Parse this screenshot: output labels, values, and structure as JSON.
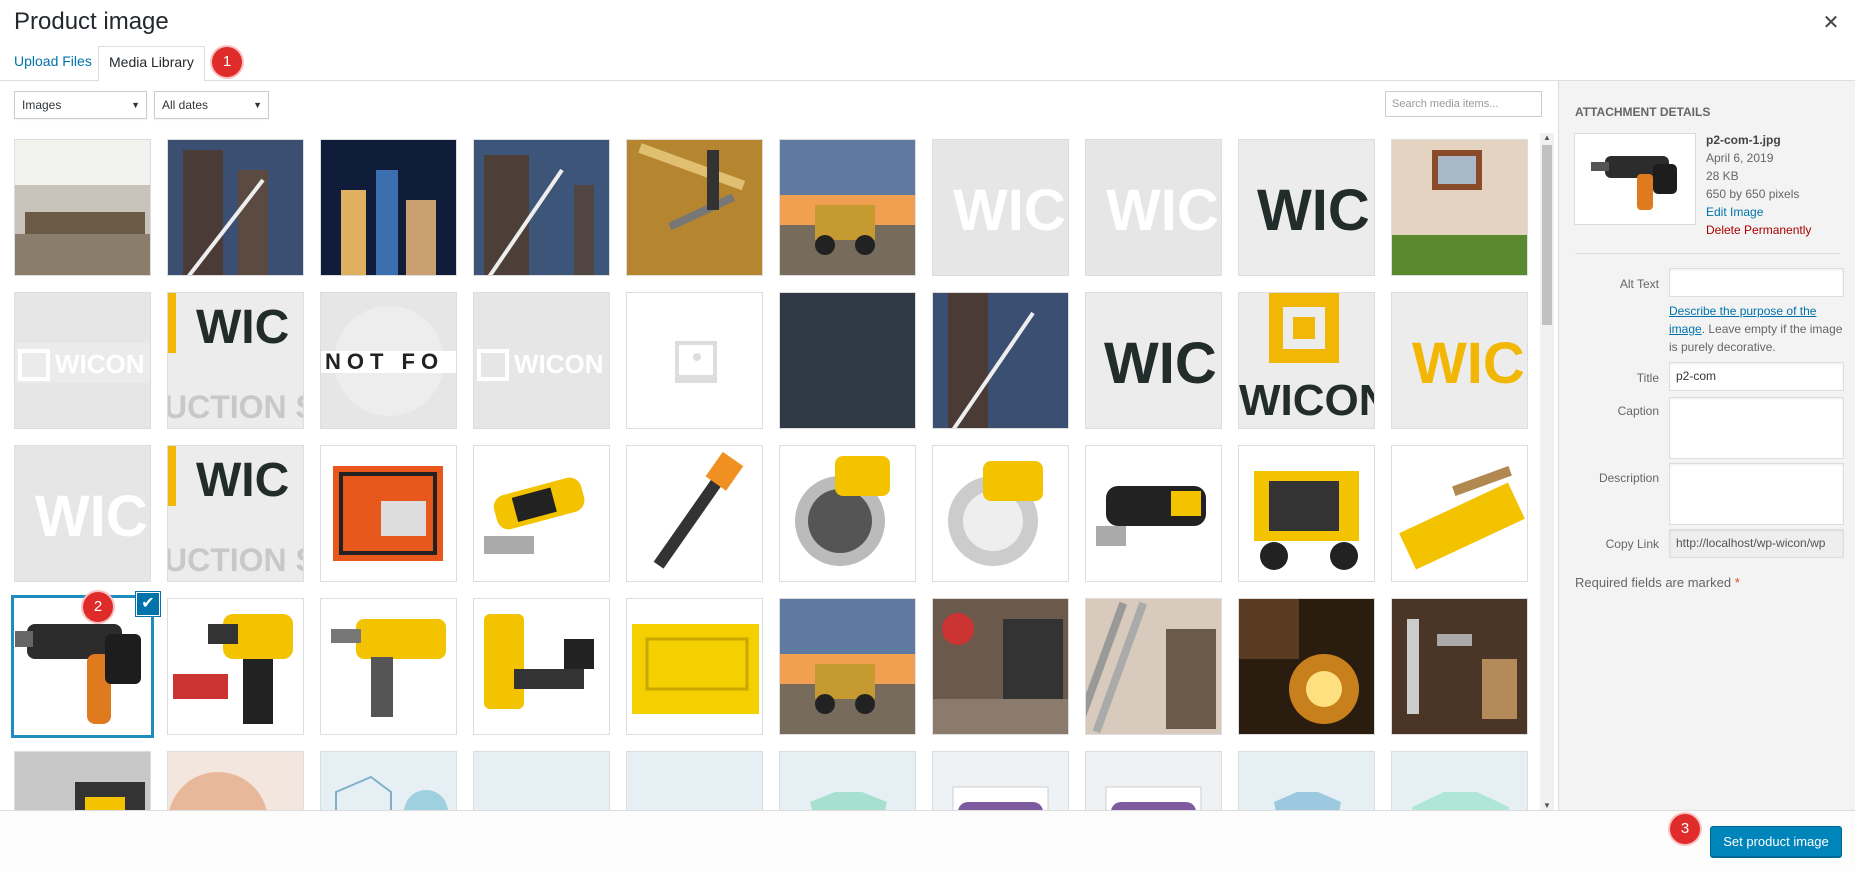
{
  "modal": {
    "title": "Product image",
    "close_glyph": "✕"
  },
  "tabs": [
    {
      "label": "Upload Files"
    },
    {
      "label": "Media Library",
      "active": true
    }
  ],
  "filters": {
    "type_value": "Images",
    "date_value": "All dates",
    "search_placeholder": "Search media items..."
  },
  "badges": [
    "1",
    "2",
    "3"
  ],
  "grid": {
    "tiles": [
      "conference-room photo",
      "bridge at dusk photo",
      "city night skyline photo",
      "bridge at dusk photo",
      "tools on wood photo",
      "excavator at sunset photo",
      "WIC logo placeholder",
      "WIC logo placeholder",
      "WIC logo dark",
      "window and grass photo",
      "WICON logo white",
      "WICO construction logo",
      "NOT FOR logo",
      "WICON logo white",
      "image placeholder icon",
      "dark solid color",
      "bridge tower photo",
      "WIC logo dark",
      "WICON yellow logo",
      "WIC yellow logo",
      "WIC logo placeholder",
      "WICO construction logo",
      "orange generator",
      "yellow multi-tool",
      "pickaxe",
      "yellow circular saw",
      "white circular saw",
      "oscillating multi-tool",
      "yellow generator",
      "miter saw box",
      "rotary hammer drill",
      "cordless drill set",
      "yellow rotary hammer",
      "yellow nail gun",
      "yellow power container",
      "excavator at sunset photo",
      "welder photo",
      "worker with pipe photo",
      "sparks grinding photo",
      "hand tools photo",
      "machinery photo",
      "smiling man photo",
      "hoodie and beanie",
      "clothing item",
      "cap",
      "t-shirt",
      "WOO poster",
      "WOO poster",
      "polo shirt",
      "long sleeve tee"
    ],
    "selected_index": 30,
    "check_glyph": "✔"
  },
  "details": {
    "heading": "Attachment Details",
    "filename": "p2-com-1.jpg",
    "date": "April 6, 2019",
    "size": "28 KB",
    "dimensions": "650 by 650 pixels",
    "edit_link": "Edit Image",
    "delete_link": "Delete Permanently",
    "alt_label": "Alt Text",
    "alt_value": "",
    "help_link": "Describe the purpose of the image",
    "help_rest": ". Leave empty if the image is purely decorative.",
    "title_label": "Title",
    "title_value": "p2-com",
    "caption_label": "Caption",
    "caption_value": "",
    "description_label": "Description",
    "description_value": "",
    "copy_label": "Copy Link",
    "copy_value": "http://localhost/wp-wicon/wp",
    "required_note": "Required fields are marked",
    "required_star": "*"
  },
  "footer": {
    "primary_label": "Set product image"
  },
  "colors": {
    "accent": "#0073aa",
    "primary_button": "#0085ba",
    "badge": "#e02b2b",
    "delete": "#a00000"
  }
}
